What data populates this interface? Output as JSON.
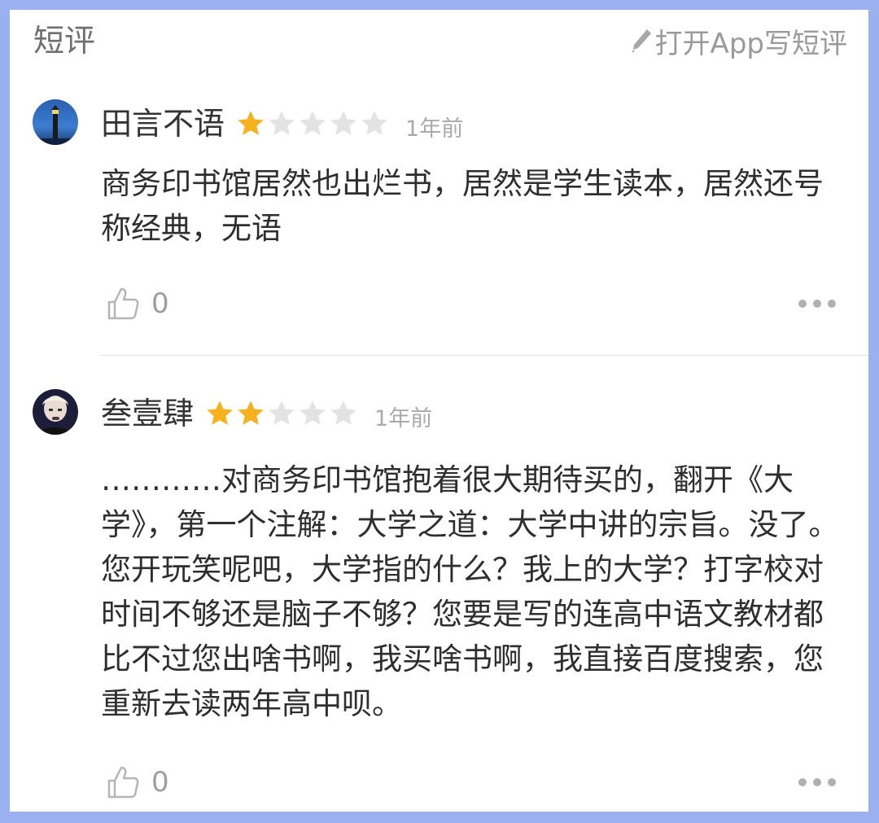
{
  "header": {
    "title": "短评",
    "write_label": "打开App写短评",
    "write_icon": "pencil-icon"
  },
  "colors": {
    "star_on": "#f6b21e",
    "star_off": "#e3e3e3",
    "frame_border": "#9bb0ee"
  },
  "reviews": [
    {
      "username": "田言不语",
      "rating": 1,
      "max_rating": 5,
      "time": "1年前",
      "text": "商务印书馆居然也出烂书，居然是学生读本，居然还号称经典，无语",
      "likes": "0"
    },
    {
      "username": "叁壹肆",
      "rating": 2,
      "max_rating": 5,
      "time": "1年前",
      "text": "…………对商务印书馆抱着很大期待买的，翻开《大学》，第一个注解：大学之道：大学中讲的宗旨。没了。您开玩笑呢吧，大学指的什么？我上的大学？打字校对时间不够还是脑子不够？您要是写的连高中语文教材都比不过您出啥书啊，我买啥书啊，我直接百度搜索，您重新去读两年高中呗。",
      "likes": "0"
    }
  ]
}
